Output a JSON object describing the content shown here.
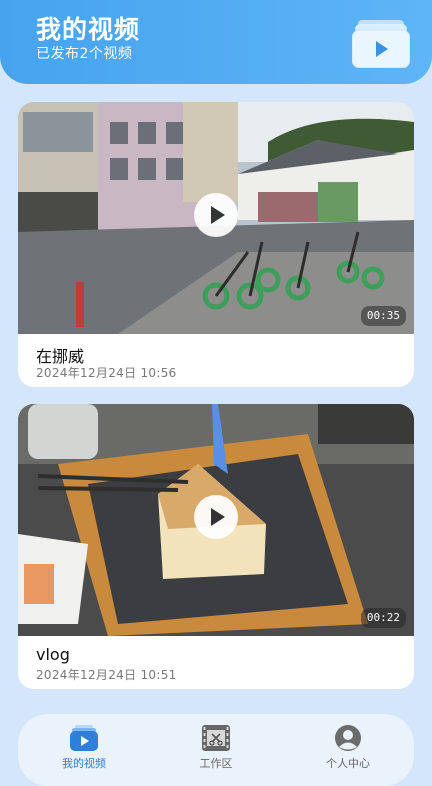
{
  "header": {
    "title": "我的视频",
    "subtitle": "已发布2个视频",
    "icon": "video-folder-icon"
  },
  "videos": [
    {
      "title": "在挪威",
      "date": "2024年12月24日 10:56",
      "duration": "00:35"
    },
    {
      "title": "vlog",
      "date": "2024年12月24日 10:51",
      "duration": "00:22"
    }
  ],
  "tabbar": {
    "active_index": 0,
    "tabs": [
      {
        "label": "我的视频",
        "icon": "video-icon"
      },
      {
        "label": "工作区",
        "icon": "film-edit-icon"
      },
      {
        "label": "个人中心",
        "icon": "user-icon"
      }
    ]
  },
  "colors": {
    "accent": "#46a3ee",
    "background": "#d4e6fb",
    "active_tab": "#2f7ed8"
  }
}
